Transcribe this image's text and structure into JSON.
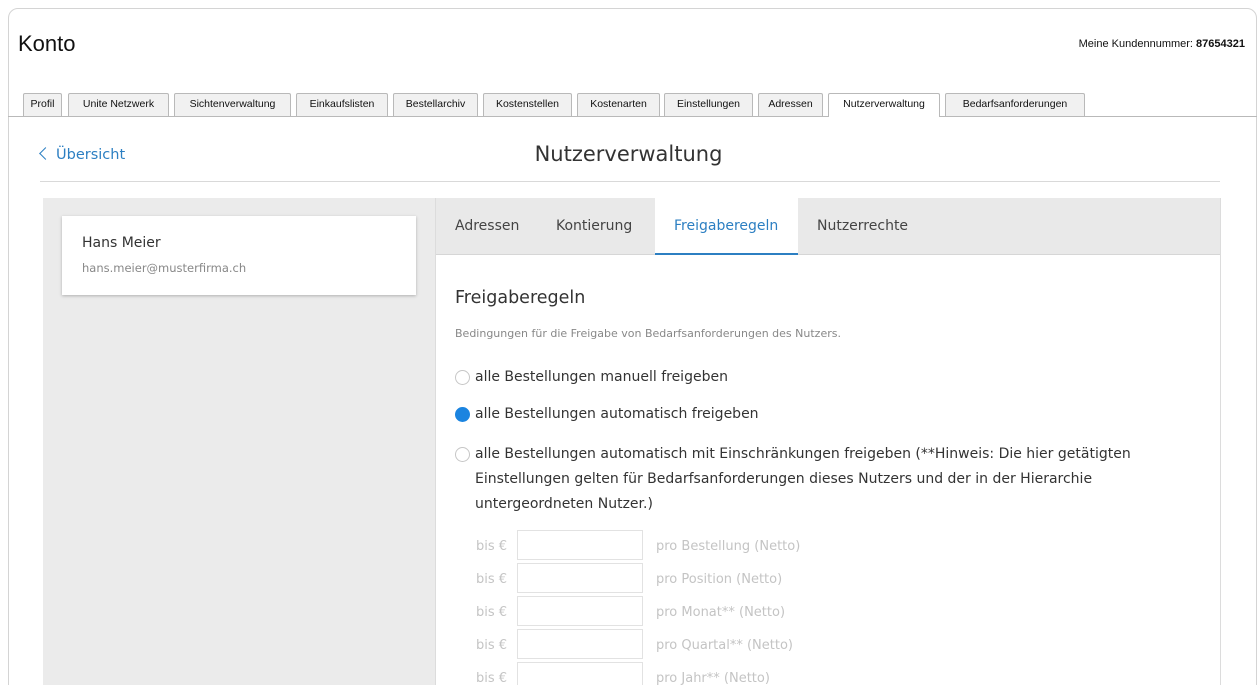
{
  "header": {
    "title": "Konto",
    "customer_number_label": "Meine Kundennummer:",
    "customer_number": "87654321"
  },
  "main_tabs": [
    {
      "label": "Profil"
    },
    {
      "label": "Unite Netzwerk"
    },
    {
      "label": "Sichtenverwaltung"
    },
    {
      "label": "Einkaufslisten"
    },
    {
      "label": "Bestellarchiv"
    },
    {
      "label": "Kostenstellen"
    },
    {
      "label": "Kostenarten"
    },
    {
      "label": "Einstellungen"
    },
    {
      "label": "Adressen"
    },
    {
      "label": "Nutzerverwaltung",
      "active": true
    },
    {
      "label": "Bedarfsanforderungen"
    }
  ],
  "page": {
    "back_label": "Übersicht",
    "title": "Nutzerverwaltung"
  },
  "user": {
    "name": "Hans Meier",
    "email": "hans.meier@musterfirma.ch"
  },
  "sub_tabs": [
    {
      "label": "Adressen"
    },
    {
      "label": "Kontierung"
    },
    {
      "label": "Freigaberegeln",
      "active": true
    },
    {
      "label": "Nutzerrechte"
    }
  ],
  "rules": {
    "title": "Freigaberegeln",
    "description": "Bedingungen für die Freigabe von Bedarfsanforderungen des Nutzers.",
    "options": [
      {
        "label": "alle Bestellungen manuell freigeben",
        "checked": false
      },
      {
        "label": "alle Bestellungen automatisch freigeben",
        "checked": true
      },
      {
        "lines": [
          "alle Bestellungen automatisch mit Einschränkungen freigeben (**Hinweis: Die hier getätigten",
          "Einstellungen gelten für Bedarfsanforderungen dieses Nutzers und der in der Hierarchie",
          "untergeordneten Nutzer.)"
        ],
        "checked": false
      }
    ],
    "limits": [
      {
        "prefix": "bis €",
        "value": "",
        "label": "pro Bestellung (Netto)"
      },
      {
        "prefix": "bis €",
        "value": "",
        "label": "pro Position (Netto)"
      },
      {
        "prefix": "bis €",
        "value": "",
        "label": "pro Monat** (Netto)"
      },
      {
        "prefix": "bis €",
        "value": "",
        "label": "pro Quartal** (Netto)"
      },
      {
        "prefix": "bis €",
        "value": "",
        "label": "pro Jahr** (Netto)"
      }
    ]
  },
  "colors": {
    "accent": "#2c7fc2",
    "radio_checked": "#1b84e0",
    "panel_bg": "#ebebeb",
    "disabled_text": "#c4c4c4"
  }
}
